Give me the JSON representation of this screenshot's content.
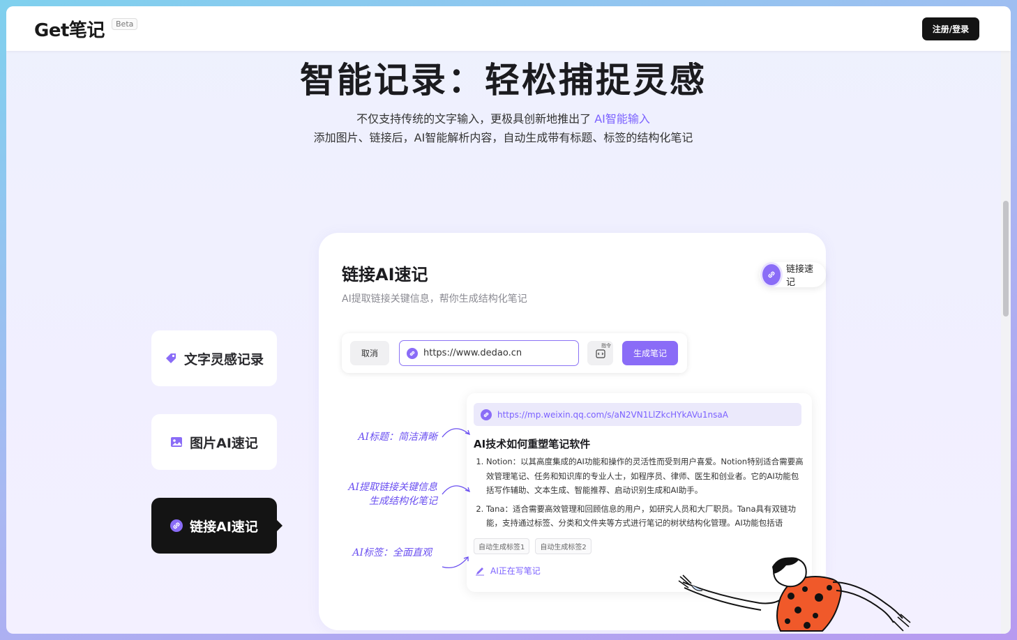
{
  "header": {
    "logo_text": "Get",
    "logo_cn": "笔记",
    "badge": "Beta",
    "login_label": "注册/登录"
  },
  "hero": {
    "title": "智能记录：轻松捕捉灵感",
    "line1_prefix": "不仅支持传统的文字输入，更极具创新地推出了 ",
    "line1_accent": "AI智能输入",
    "line2": "添加图片、链接后，AI智能解析内容，自动生成带有标题、标签的结构化笔记"
  },
  "side_tabs": [
    {
      "label": "文字灵感记录",
      "icon": "tag-icon",
      "active": false
    },
    {
      "label": "图片AI速记",
      "icon": "image-icon",
      "active": false
    },
    {
      "label": "链接AI速记",
      "icon": "link-icon",
      "active": true
    }
  ],
  "card": {
    "title": "链接AI速记",
    "subtitle": "AI提取链接关键信息，帮你生成结构化笔记",
    "chip_label": "链接速记",
    "input": {
      "cancel_label": "取消",
      "url_value": "https://www.dedao.cn",
      "cmd_label": "指令",
      "generate_label": "生成笔记"
    },
    "note": {
      "source_url": "https://mp.weixin.qq.com/s/aN2VN1LlZkcHYkAVu1nsaA",
      "title": "AI技术如何重塑笔记软件",
      "items": [
        "Notion：以其高度集成的AI功能和操作的灵活性而受到用户喜爱。Notion特别适合需要高效管理笔记、任务和知识库的专业人士，如程序员、律师、医生和创业者。它的AI功能包括写作辅助、文本生成、智能推荐、启动识别生成和AI助手。",
        "Tana：适合需要高效管理和回顾信息的用户，如研究人员和大厂职员。Tana具有双链功能，支持通过标签、分类和文件夹等方式进行笔记的树状结构化管理。AI功能包括语"
      ],
      "tags": [
        "自动生成标签1",
        "自动生成标签2"
      ],
      "writing_status": "AI正在写笔记"
    }
  },
  "annotations": [
    {
      "text": "AI标题：简洁清晰"
    },
    {
      "text": "AI提取链接关键信息\n生成结构化笔记"
    },
    {
      "text": "AI标签：全面直观"
    }
  ],
  "colors": {
    "accent": "#7b61ff",
    "button_dark": "#141414",
    "primary_button": "#8a6cf7"
  }
}
